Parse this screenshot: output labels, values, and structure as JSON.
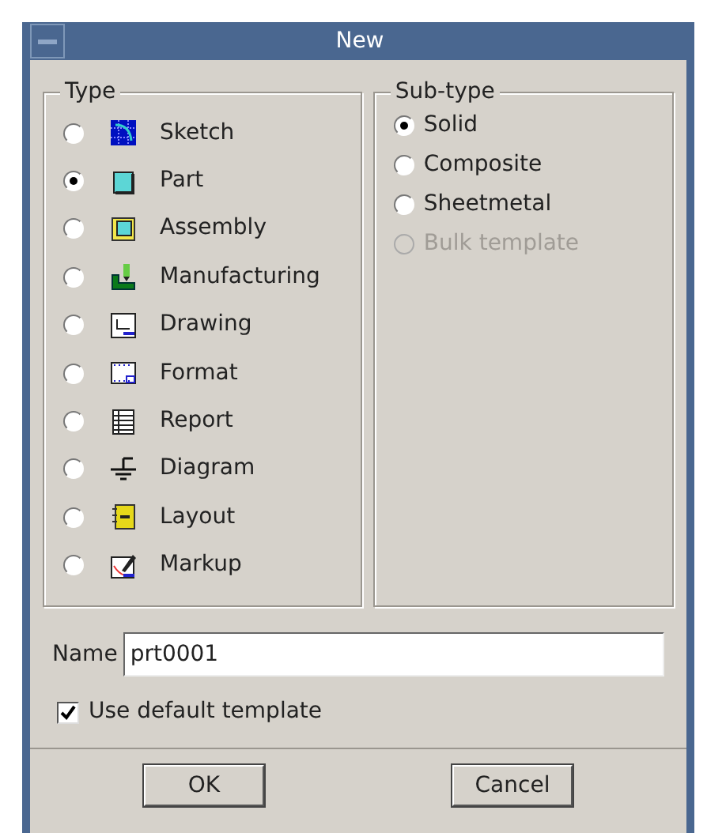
{
  "window": {
    "title": "New"
  },
  "type_group": {
    "label": "Type",
    "items": [
      {
        "label": "Sketch",
        "selected": false
      },
      {
        "label": "Part",
        "selected": true
      },
      {
        "label": "Assembly",
        "selected": false
      },
      {
        "label": "Manufacturing",
        "selected": false
      },
      {
        "label": "Drawing",
        "selected": false
      },
      {
        "label": "Format",
        "selected": false
      },
      {
        "label": "Report",
        "selected": false
      },
      {
        "label": "Diagram",
        "selected": false
      },
      {
        "label": "Layout",
        "selected": false
      },
      {
        "label": "Markup",
        "selected": false
      }
    ]
  },
  "subtype_group": {
    "label": "Sub-type",
    "items": [
      {
        "label": "Solid",
        "selected": true,
        "disabled": false
      },
      {
        "label": "Composite",
        "selected": false,
        "disabled": false
      },
      {
        "label": "Sheetmetal",
        "selected": false,
        "disabled": false
      },
      {
        "label": "Bulk template",
        "selected": false,
        "disabled": true
      }
    ]
  },
  "name_field": {
    "label": "Name",
    "value": "prt0001"
  },
  "use_default_template": {
    "label": "Use default template",
    "checked": true
  },
  "buttons": [
    "OK",
    "Cancel"
  ]
}
